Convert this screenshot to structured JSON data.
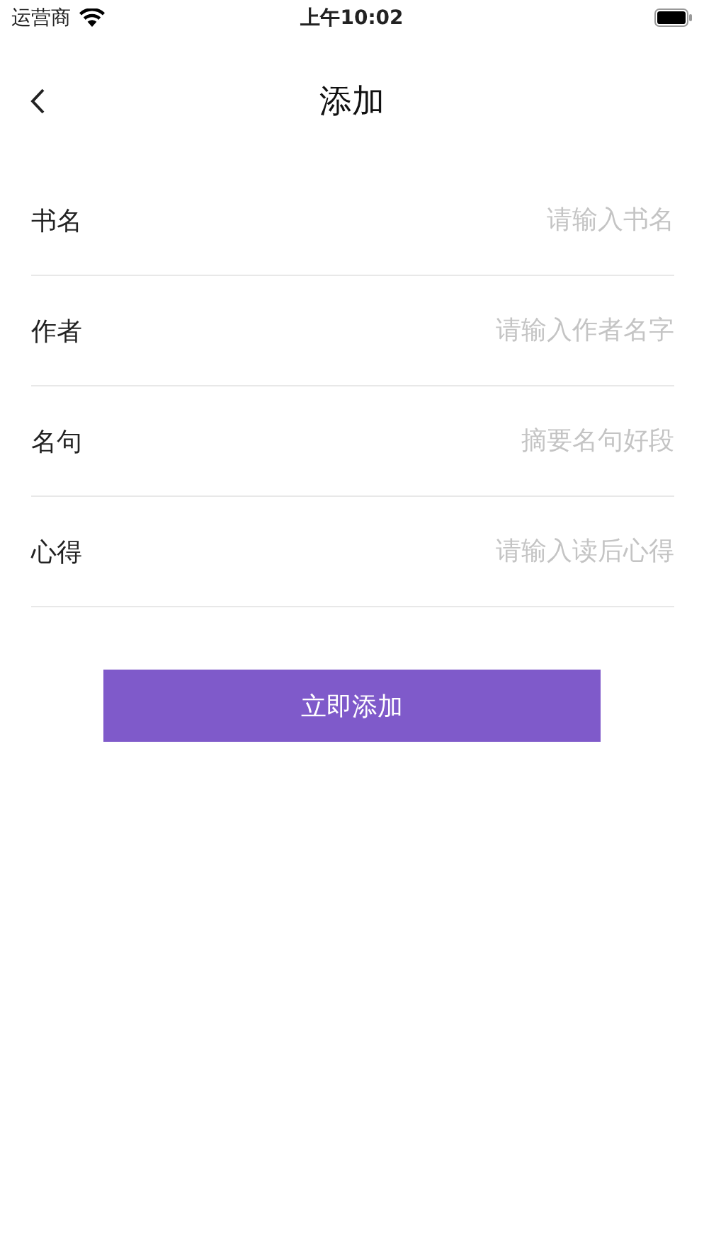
{
  "status_bar": {
    "carrier": "运营商",
    "time": "上午10:02"
  },
  "nav": {
    "title": "添加"
  },
  "fields": [
    {
      "label": "书名",
      "placeholder": "请输入书名"
    },
    {
      "label": "作者",
      "placeholder": "请输入作者名字"
    },
    {
      "label": "名句",
      "placeholder": "摘要名句好段"
    },
    {
      "label": "心得",
      "placeholder": "请输入读后心得"
    }
  ],
  "submit_button": "立即添加"
}
